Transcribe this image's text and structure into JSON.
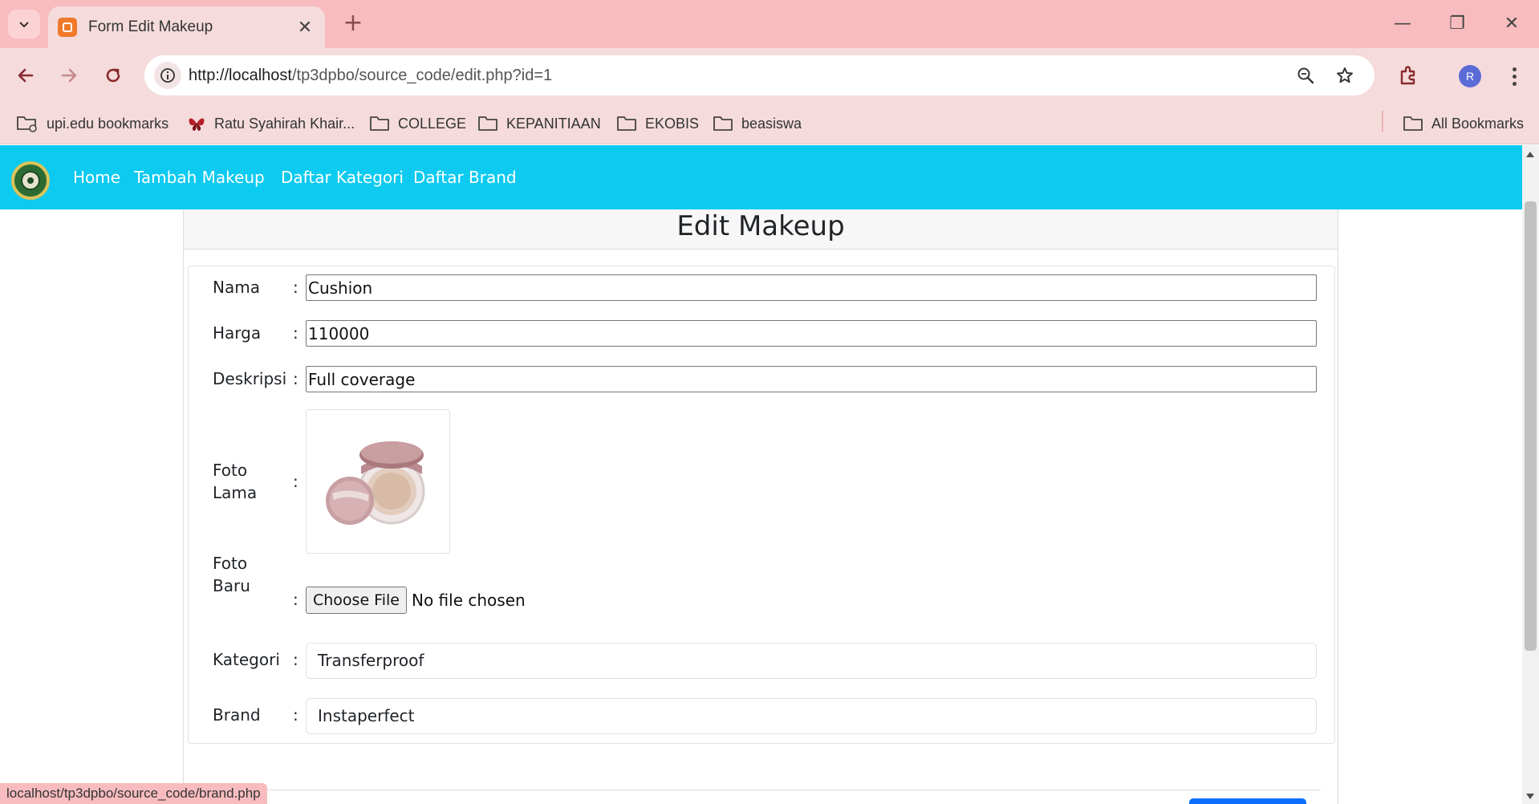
{
  "browser": {
    "tab_title": "Form Edit Makeup",
    "tab_close": "✕",
    "new_tab": "+",
    "window_controls": {
      "minimize": "—",
      "restore": "❐",
      "close": "✕"
    },
    "url_host": "http://localhost",
    "url_path": "/tp3dpbo/source_code/edit.php?id=1",
    "avatar_letter": "R",
    "bookmarks": [
      {
        "label": "upi.edu bookmarks",
        "icon": "managed-folder-icon"
      },
      {
        "label": "Ratu Syahirah Khair...",
        "icon": "butterfly-favicon"
      },
      {
        "label": "COLLEGE",
        "icon": "folder-icon"
      },
      {
        "label": "KEPANITIAAN",
        "icon": "folder-icon"
      },
      {
        "label": "EKOBIS",
        "icon": "folder-icon"
      },
      {
        "label": "beasiswa",
        "icon": "folder-icon"
      }
    ],
    "all_bookmarks": "All Bookmarks",
    "status_url": "localhost/tp3dpbo/source_code/brand.php"
  },
  "navbar": {
    "links": [
      "Home",
      "Tambah Makeup",
      "Daftar Kategori",
      "Daftar Brand"
    ],
    "accent_color": "#0dcaf0"
  },
  "form": {
    "title": "Edit Makeup",
    "separator": ":",
    "nama": {
      "label": "Nama",
      "value": "Cushion"
    },
    "harga": {
      "label": "Harga",
      "value": "110000"
    },
    "deskripsi": {
      "label": "Deskripsi",
      "value": "Full coverage"
    },
    "foto_lama": {
      "label_1": "Foto",
      "label_2": "Lama",
      "image": "cushion-compact-image"
    },
    "foto_baru": {
      "label_1": "Foto",
      "label_2": "Baru",
      "button": "Choose File",
      "status": "No file chosen"
    },
    "kategori": {
      "label": "Kategori",
      "value": "Transferproof"
    },
    "brand": {
      "label": "Brand",
      "value": "Instaperfect"
    }
  }
}
